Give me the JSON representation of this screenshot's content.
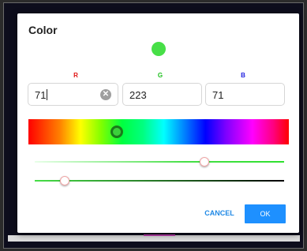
{
  "dialog": {
    "title": "Color",
    "preview_color": "#47df47"
  },
  "channels": {
    "r": {
      "label": "R",
      "value": "71",
      "color": "#e01010"
    },
    "g": {
      "label": "G",
      "value": "223",
      "color": "#20c020"
    },
    "b": {
      "label": "B",
      "value": "71",
      "color": "#2020e0"
    }
  },
  "sliders": {
    "hue": {
      "fraction": 0.34
    },
    "saturation": {
      "fraction": 0.68
    },
    "value": {
      "fraction": 0.12
    }
  },
  "icons": {
    "clear": "clear-circle-icon"
  },
  "buttons": {
    "cancel": "CANCEL",
    "ok": "OK"
  }
}
